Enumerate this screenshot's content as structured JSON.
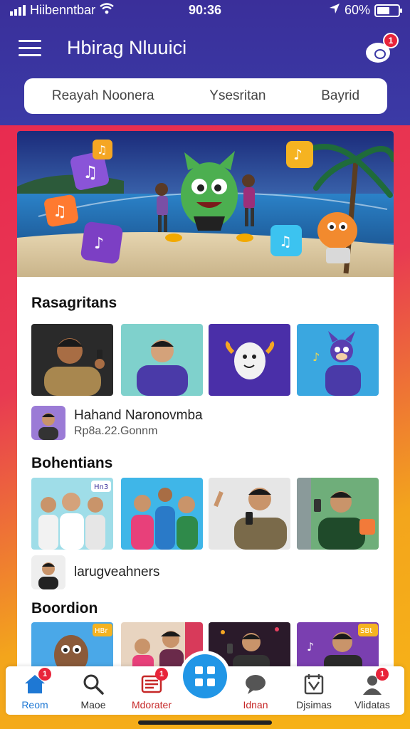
{
  "status_bar": {
    "carrier": "Hiibenntbar",
    "time": "90:36",
    "battery": "60%",
    "battery_level": 0.6
  },
  "header": {
    "title": "Hbirag Nluuici",
    "chat_badge": "1"
  },
  "segments": [
    "Reayah Noonera",
    "Ysesritan",
    "Bayrid"
  ],
  "sections": [
    {
      "title": "Rasagritans",
      "person": {
        "name": "Hahand Naronovmba",
        "sub": "Rp8a.22.Gonnm"
      }
    },
    {
      "title": "Bohentians",
      "person": {
        "name": "larugveahners"
      }
    },
    {
      "title": "Boordion",
      "thumb_badges": [
        "HBr",
        "SBt"
      ]
    }
  ],
  "thumb_badges_row2": [
    "Hn3"
  ],
  "tabs": [
    {
      "label": "Reom",
      "icon": "home-icon",
      "badge": "1",
      "color": "#1e78d4"
    },
    {
      "label": "Maoe",
      "icon": "search-icon",
      "color": "#333333"
    },
    {
      "label": "Mdorater",
      "icon": "inbox-icon",
      "badge": "1",
      "color": "#c62828"
    },
    {
      "label": "Idnan",
      "icon": "chat-icon",
      "color": "#333333"
    },
    {
      "label": "Djsimas",
      "icon": "calendar-icon",
      "color": "#333333"
    },
    {
      "label": "Vlidatas",
      "icon": "profile-icon",
      "badge": "1",
      "color": "#333333"
    }
  ],
  "colors": {
    "header": "#3b3aa6",
    "accent": "#2196e6",
    "badge": "#e8243a"
  }
}
